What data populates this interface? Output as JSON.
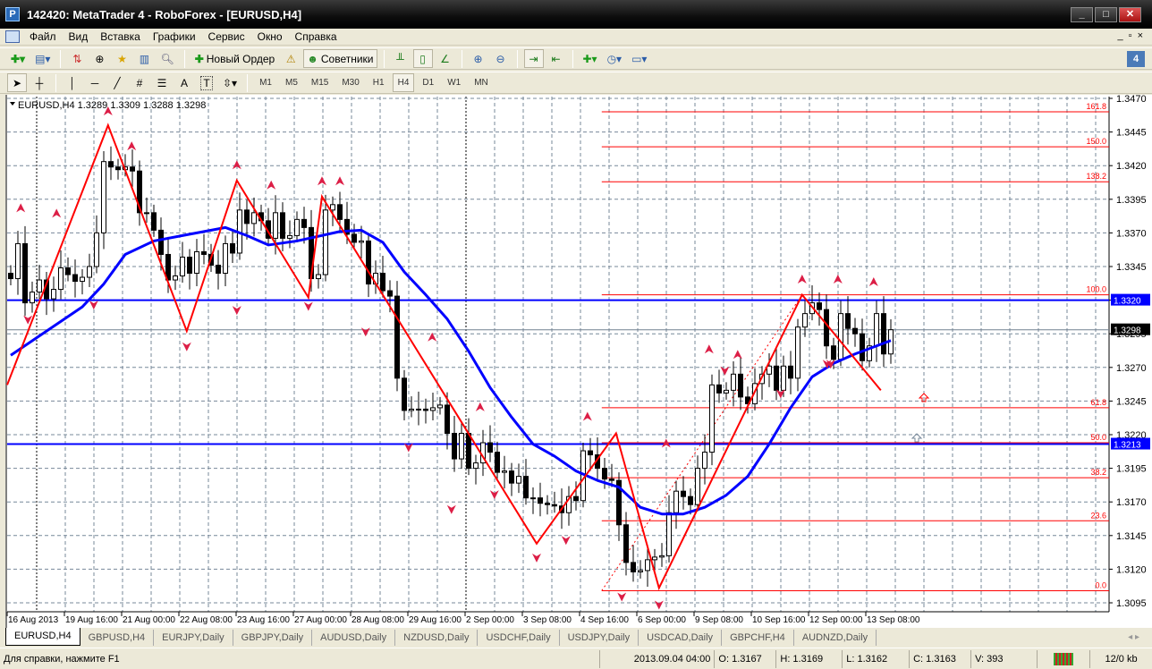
{
  "window": {
    "title": "142420: MetaTrader 4 - RoboForex - [EURUSD,H4]",
    "logo": "P",
    "min": "_",
    "max": "□",
    "close": "✕"
  },
  "menu": [
    "Файл",
    "Вид",
    "Вставка",
    "Графики",
    "Сервис",
    "Окно",
    "Справка"
  ],
  "mdi": [
    "_",
    "▫",
    "×"
  ],
  "toolbar": {
    "new_order": "Новый Ордер",
    "experts": "Советники",
    "badge": "4"
  },
  "draw_tools": {
    "text_tool": "A",
    "label_tool": "T"
  },
  "timeframes": [
    "M1",
    "M5",
    "M15",
    "M30",
    "H1",
    "H4",
    "D1",
    "W1",
    "MN"
  ],
  "active_timeframe": "H4",
  "chart_header": "EURUSD,H4  1.3289 1.3309 1.3288 1.3298",
  "price_labels": [
    "1.3470",
    "1.3445",
    "1.3420",
    "1.3395",
    "1.3370",
    "1.3345",
    "1.3320",
    "1.3295",
    "1.3270",
    "1.3245",
    "1.3220",
    "1.3195",
    "1.3170",
    "1.3145",
    "1.3120",
    "1.3095"
  ],
  "hlines": [
    {
      "price": 1.332,
      "label": "1.3320",
      "color": "#0000ff"
    },
    {
      "price": 1.3213,
      "label": "1.3213",
      "color": "#0000ff"
    }
  ],
  "bid": {
    "price": 1.3298,
    "label": "1.3298"
  },
  "fib_levels": [
    {
      "label": "161.8",
      "price": 1.346
    },
    {
      "label": "150.0",
      "price": 1.3434
    },
    {
      "label": "138.2",
      "price": 1.3408
    },
    {
      "label": "100.0",
      "price": 1.3324
    },
    {
      "label": "61.8",
      "price": 1.324
    },
    {
      "label": "50.0",
      "price": 1.3214
    },
    {
      "label": "38.2",
      "price": 1.3188
    },
    {
      "label": "23.6",
      "price": 1.3156
    },
    {
      "label": "0.0",
      "price": 1.3104
    }
  ],
  "time_labels": [
    "16 Aug 2013",
    "19 Aug 16:00",
    "21 Aug 00:00",
    "22 Aug 08:00",
    "23 Aug 16:00",
    "27 Aug 00:00",
    "28 Aug 08:00",
    "29 Aug 16:00",
    "2 Sep 00:00",
    "3 Sep 08:00",
    "4 Sep 16:00",
    "6 Sep 00:00",
    "9 Sep 08:00",
    "10 Sep 16:00",
    "12 Sep 00:00",
    "13 Sep 08:00"
  ],
  "tabs": [
    "EURUSD,H4",
    "GBPUSD,H4",
    "EURJPY,Daily",
    "GBPJPY,Daily",
    "AUDUSD,Daily",
    "NZDUSD,Daily",
    "USDCHF,Daily",
    "USDJPY,Daily",
    "USDCAD,Daily",
    "GBPCHF,H4",
    "AUDNZD,Daily"
  ],
  "tab_arrows": "◂ ▸",
  "status": {
    "help": "Для справки, нажмите F1",
    "time": "2013.09.04 04:00",
    "open": "O: 1.3167",
    "high": "H: 1.3169",
    "low": "L: 1.3162",
    "close": "C: 1.3163",
    "volume": "V: 393",
    "traffic": "12/0 kb"
  },
  "colors": {
    "zigzag": "#ff0000",
    "ma": "#0000ff",
    "fractal": "#dc1e46",
    "grid": "#778899"
  },
  "chart_data": {
    "type": "candlestick",
    "symbol": "EURUSD",
    "timeframe": "H4",
    "ylim": [
      1.3095,
      1.347
    ],
    "first_open": 1.334,
    "close": [
      1.3336,
      1.3362,
      1.3318,
      1.3326,
      1.3335,
      1.3321,
      1.3328,
      1.3344,
      1.3339,
      1.3334,
      1.3337,
      1.3345,
      1.337,
      1.3423,
      1.3419,
      1.3417,
      1.3419,
      1.3416,
      1.3385,
      1.3385,
      1.3372,
      1.3354,
      1.3335,
      1.3338,
      1.3352,
      1.334,
      1.3356,
      1.3354,
      1.3346,
      1.334,
      1.3362,
      1.3355,
      1.3387,
      1.3377,
      1.3385,
      1.3379,
      1.3366,
      1.3385,
      1.3366,
      1.3368,
      1.338,
      1.3374,
      1.3336,
      1.3339,
      1.3387,
      1.3391,
      1.338,
      1.3369,
      1.3363,
      1.3364,
      1.3332,
      1.334,
      1.3327,
      1.3323,
      1.3262,
      1.3238,
      1.3239,
      1.3239,
      1.3238,
      1.324,
      1.3242,
      1.3221,
      1.3202,
      1.3221,
      1.3195,
      1.3199,
      1.3214,
      1.3207,
      1.3192,
      1.3193,
      1.3184,
      1.3189,
      1.3173,
      1.3173,
      1.3169,
      1.3168,
      1.3167,
      1.3162,
      1.3174,
      1.3171,
      1.3208,
      1.3205,
      1.3195,
      1.3187,
      1.3186,
      1.3153,
      1.3125,
      1.3118,
      1.3119,
      1.3127,
      1.3129,
      1.313,
      1.3162,
      1.3178,
      1.3174,
      1.3168,
      1.3195,
      1.3207,
      1.3257,
      1.3251,
      1.3253,
      1.3265,
      1.3248,
      1.3243,
      1.3258,
      1.3265,
      1.3271,
      1.3253,
      1.3271,
      1.3262,
      1.33,
      1.331,
      1.3318,
      1.3313,
      1.3286,
      1.3276,
      1.331,
      1.3299,
      1.3295,
      1.3275,
      1.3286,
      1.331,
      1.328,
      1.3298
    ],
    "ma": [
      [
        0,
        1.3279
      ],
      [
        10,
        1.3315
      ],
      [
        13,
        1.3332
      ],
      [
        16,
        1.3354
      ],
      [
        20,
        1.3364
      ],
      [
        25,
        1.3369
      ],
      [
        30,
        1.3374
      ],
      [
        33,
        1.3368
      ],
      [
        36,
        1.3361
      ],
      [
        40,
        1.3364
      ],
      [
        46,
        1.3371
      ],
      [
        49,
        1.3372
      ],
      [
        52,
        1.3363
      ],
      [
        55,
        1.3341
      ],
      [
        58,
        1.3324
      ],
      [
        61,
        1.3306
      ],
      [
        64,
        1.3282
      ],
      [
        67,
        1.3255
      ],
      [
        70,
        1.3233
      ],
      [
        73,
        1.3213
      ],
      [
        76,
        1.3204
      ],
      [
        79,
        1.3193
      ],
      [
        82,
        1.3186
      ],
      [
        85,
        1.3181
      ],
      [
        88,
        1.3166
      ],
      [
        91,
        1.3161
      ],
      [
        94,
        1.3161
      ],
      [
        97,
        1.3166
      ],
      [
        100,
        1.3175
      ],
      [
        103,
        1.3189
      ],
      [
        106,
        1.3213
      ],
      [
        109,
        1.324
      ],
      [
        112,
        1.3263
      ],
      [
        115,
        1.3273
      ],
      [
        118,
        1.328
      ],
      [
        121,
        1.3286
      ],
      [
        123,
        1.329
      ]
    ],
    "zigzag": [
      [
        -0.5,
        1.3257
      ],
      [
        13.6,
        1.345
      ],
      [
        24.6,
        1.3297
      ],
      [
        31.6,
        1.3409
      ],
      [
        41.6,
        1.3322
      ],
      [
        43.5,
        1.3397
      ],
      [
        73.5,
        1.3139
      ],
      [
        84.6,
        1.3221
      ],
      [
        90.6,
        1.3106
      ],
      [
        110.6,
        1.3324
      ],
      [
        121.6,
        1.3253
      ]
    ],
    "fib_base": [
      [
        82.6,
        1.3104
      ],
      [
        110.6,
        1.3324
      ]
    ],
    "fractals_up": [
      [
        1.4,
        1.3388
      ],
      [
        6.4,
        1.3384
      ],
      [
        13.6,
        1.346
      ],
      [
        16.9,
        1.3434
      ],
      [
        31.6,
        1.342
      ],
      [
        36.4,
        1.3405
      ],
      [
        43.5,
        1.3408
      ],
      [
        46,
        1.3408
      ],
      [
        58.9,
        1.3292
      ],
      [
        65.6,
        1.324
      ],
      [
        80.6,
        1.3233
      ],
      [
        91.6,
        1.3213
      ],
      [
        97.6,
        1.3283
      ],
      [
        101.6,
        1.3279
      ],
      [
        110.6,
        1.3335
      ],
      [
        115.6,
        1.3335
      ],
      [
        120.6,
        1.3333
      ]
    ],
    "fractals_down": [
      [
        2.4,
        1.3306
      ],
      [
        11.6,
        1.3317
      ],
      [
        24.6,
        1.3286
      ],
      [
        31.6,
        1.3313
      ],
      [
        41.6,
        1.3316
      ],
      [
        49.6,
        1.3297
      ],
      [
        55.6,
        1.3211
      ],
      [
        61.6,
        1.3165
      ],
      [
        67.6,
        1.3176
      ],
      [
        73.5,
        1.3129
      ],
      [
        77.6,
        1.3142
      ],
      [
        85.4,
        1.31
      ],
      [
        90.6,
        1.3094
      ],
      [
        99.8,
        1.3268
      ],
      [
        107.6,
        1.3251
      ],
      [
        114.1,
        1.3273
      ],
      [
        114.6,
        1.3273
      ]
    ]
  }
}
